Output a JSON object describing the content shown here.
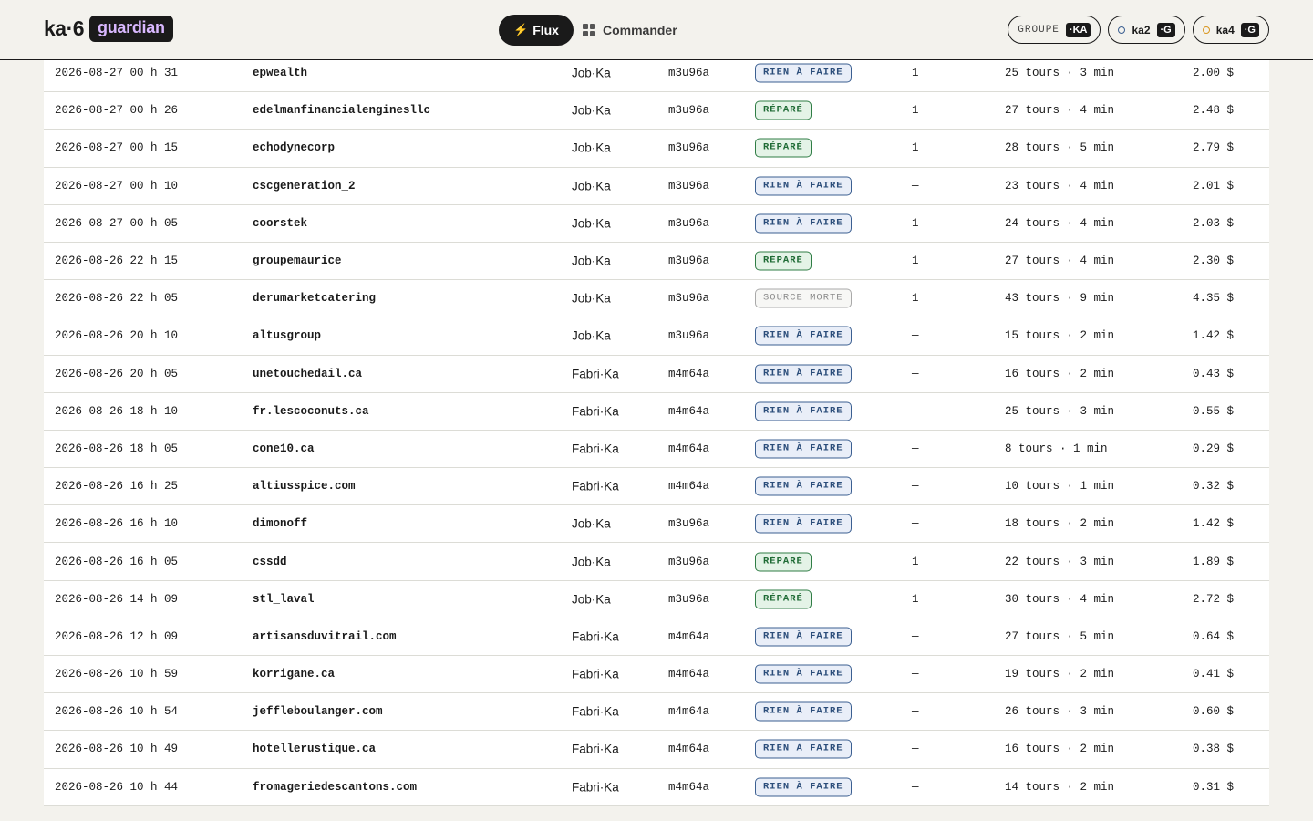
{
  "header": {
    "logo_text": "ka·6",
    "logo_badge": "guardian",
    "nav": [
      {
        "label": "Flux",
        "icon": "bolt-icon",
        "active": true
      },
      {
        "label": "Commander",
        "icon": "grid-icon",
        "active": false
      }
    ],
    "pills": [
      {
        "label": "GROUPE",
        "chip": "·KA"
      },
      {
        "name": "ka2",
        "chip": "·G",
        "dot_color": "#3b5f91"
      },
      {
        "name": "ka4",
        "chip": "·G",
        "dot_color": "#d9961f"
      }
    ]
  },
  "status_labels": {
    "rien": "RIEN À FAIRE",
    "repare": "RÉPARÉ",
    "morte": "SOURCE MORTE"
  },
  "rows": [
    {
      "date": "2026-08-27 00 h 31",
      "client": "epwealth",
      "agent": "Job·Ka",
      "model": "m3u96a",
      "status": "rien",
      "fix": "1",
      "tours": "25 tours · 3 min",
      "cost": "2.00 $"
    },
    {
      "date": "2026-08-27 00 h 26",
      "client": "edelmanfinancialenginesllc",
      "agent": "Job·Ka",
      "model": "m3u96a",
      "status": "repare",
      "fix": "1",
      "tours": "27 tours · 4 min",
      "cost": "2.48 $"
    },
    {
      "date": "2026-08-27 00 h 15",
      "client": "echodynecorp",
      "agent": "Job·Ka",
      "model": "m3u96a",
      "status": "repare",
      "fix": "1",
      "tours": "28 tours · 5 min",
      "cost": "2.79 $"
    },
    {
      "date": "2026-08-27 00 h 10",
      "client": "cscgeneration_2",
      "agent": "Job·Ka",
      "model": "m3u96a",
      "status": "rien",
      "fix": "—",
      "tours": "23 tours · 4 min",
      "cost": "2.01 $"
    },
    {
      "date": "2026-08-27 00 h 05",
      "client": "coorstek",
      "agent": "Job·Ka",
      "model": "m3u96a",
      "status": "rien",
      "fix": "1",
      "tours": "24 tours · 4 min",
      "cost": "2.03 $"
    },
    {
      "date": "2026-08-26 22 h 15",
      "client": "groupemaurice",
      "agent": "Job·Ka",
      "model": "m3u96a",
      "status": "repare",
      "fix": "1",
      "tours": "27 tours · 4 min",
      "cost": "2.30 $"
    },
    {
      "date": "2026-08-26 22 h 05",
      "client": "derumarketcatering",
      "agent": "Job·Ka",
      "model": "m3u96a",
      "status": "morte",
      "fix": "1",
      "tours": "43 tours · 9 min",
      "cost": "4.35 $"
    },
    {
      "date": "2026-08-26 20 h 10",
      "client": "altusgroup",
      "agent": "Job·Ka",
      "model": "m3u96a",
      "status": "rien",
      "fix": "—",
      "tours": "15 tours · 2 min",
      "cost": "1.42 $"
    },
    {
      "date": "2026-08-26 20 h 05",
      "client": "unetouchedail.ca",
      "agent": "Fabri·Ka",
      "model": "m4m64a",
      "status": "rien",
      "fix": "—",
      "tours": "16 tours · 2 min",
      "cost": "0.43 $"
    },
    {
      "date": "2026-08-26 18 h 10",
      "client": "fr.lescoconuts.ca",
      "agent": "Fabri·Ka",
      "model": "m4m64a",
      "status": "rien",
      "fix": "—",
      "tours": "25 tours · 3 min",
      "cost": "0.55 $"
    },
    {
      "date": "2026-08-26 18 h 05",
      "client": "cone10.ca",
      "agent": "Fabri·Ka",
      "model": "m4m64a",
      "status": "rien",
      "fix": "—",
      "tours": "8 tours · 1 min",
      "cost": "0.29 $"
    },
    {
      "date": "2026-08-26 16 h 25",
      "client": "altiusspice.com",
      "agent": "Fabri·Ka",
      "model": "m4m64a",
      "status": "rien",
      "fix": "—",
      "tours": "10 tours · 1 min",
      "cost": "0.32 $"
    },
    {
      "date": "2026-08-26 16 h 10",
      "client": "dimonoff",
      "agent": "Job·Ka",
      "model": "m3u96a",
      "status": "rien",
      "fix": "—",
      "tours": "18 tours · 2 min",
      "cost": "1.42 $"
    },
    {
      "date": "2026-08-26 16 h 05",
      "client": "cssdd",
      "agent": "Job·Ka",
      "model": "m3u96a",
      "status": "repare",
      "fix": "1",
      "tours": "22 tours · 3 min",
      "cost": "1.89 $"
    },
    {
      "date": "2026-08-26 14 h 09",
      "client": "stl_laval",
      "agent": "Job·Ka",
      "model": "m3u96a",
      "status": "repare",
      "fix": "1",
      "tours": "30 tours · 4 min",
      "cost": "2.72 $"
    },
    {
      "date": "2026-08-26 12 h 09",
      "client": "artisansduvitrail.com",
      "agent": "Fabri·Ka",
      "model": "m4m64a",
      "status": "rien",
      "fix": "—",
      "tours": "27 tours · 5 min",
      "cost": "0.64 $"
    },
    {
      "date": "2026-08-26 10 h 59",
      "client": "korrigane.ca",
      "agent": "Fabri·Ka",
      "model": "m4m64a",
      "status": "rien",
      "fix": "—",
      "tours": "19 tours · 2 min",
      "cost": "0.41 $"
    },
    {
      "date": "2026-08-26 10 h 54",
      "client": "jeffleboulanger.com",
      "agent": "Fabri·Ka",
      "model": "m4m64a",
      "status": "rien",
      "fix": "—",
      "tours": "26 tours · 3 min",
      "cost": "0.60 $"
    },
    {
      "date": "2026-08-26 10 h 49",
      "client": "hotellerustique.ca",
      "agent": "Fabri·Ka",
      "model": "m4m64a",
      "status": "rien",
      "fix": "—",
      "tours": "16 tours · 2 min",
      "cost": "0.38 $"
    },
    {
      "date": "2026-08-26 10 h 44",
      "client": "fromageriedescantons.com",
      "agent": "Fabri·Ka",
      "model": "m4m64a",
      "status": "rien",
      "fix": "—",
      "tours": "14 tours · 2 min",
      "cost": "0.31 $"
    }
  ]
}
